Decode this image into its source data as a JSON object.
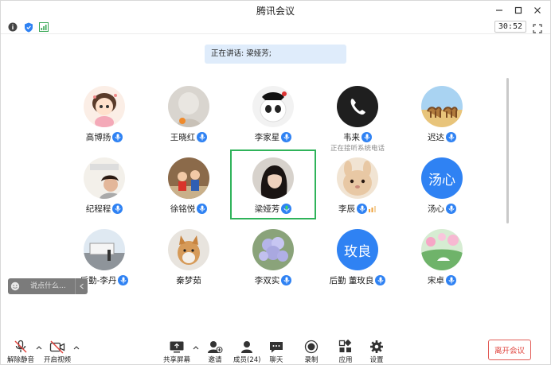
{
  "window": {
    "title": "腾讯会议"
  },
  "statusbar": {
    "timer": "30:52"
  },
  "speaking": {
    "text": "正在讲话: 梁娅芳;"
  },
  "participants": [
    {
      "name": "高博扬",
      "mic": true,
      "avatar": "photo"
    },
    {
      "name": "王晓红",
      "mic": true,
      "avatar": "photo"
    },
    {
      "name": "李家星",
      "mic": true,
      "avatar": "photo"
    },
    {
      "name": "韦来",
      "mic": true,
      "avatar": "phone",
      "status": "正在接听系统电话"
    },
    {
      "name": "迟达",
      "mic": true,
      "avatar": "photo"
    },
    {
      "name": "纪程程",
      "mic": true,
      "avatar": "photo"
    },
    {
      "name": "徐铭悦",
      "mic": true,
      "avatar": "photo"
    },
    {
      "name": "梁娅芳",
      "mic": true,
      "avatar": "photo",
      "speaking": true
    },
    {
      "name": "李辰",
      "mic": true,
      "avatar": "photo",
      "signal": true
    },
    {
      "name": "汤心",
      "mic": true,
      "avatar_text": "汤心"
    },
    {
      "name": "后勤-李丹",
      "mic": true,
      "avatar": "photo"
    },
    {
      "name": "秦梦茹",
      "mic": false,
      "avatar": "photo"
    },
    {
      "name": "李双实",
      "mic": true,
      "avatar": "photo"
    },
    {
      "name": "后勤 董玫良",
      "mic": true,
      "avatar_text": "玫良"
    },
    {
      "name": "宋卓",
      "mic": true,
      "avatar": "photo"
    }
  ],
  "chat": {
    "placeholder": "说点什么..."
  },
  "toolbar": {
    "unmute": "解除静音",
    "video": "开启视频",
    "share": "共享屏幕",
    "invite": "邀请",
    "members": "成员(24)",
    "chat": "聊天",
    "record": "录制",
    "apps": "应用",
    "settings": "设置",
    "leave": "离开会议"
  },
  "colors": {
    "accent": "#2f82f3",
    "speaking_border": "#2fb35a",
    "leave": "#e0443e",
    "speaking_bg": "#dfecfb"
  }
}
